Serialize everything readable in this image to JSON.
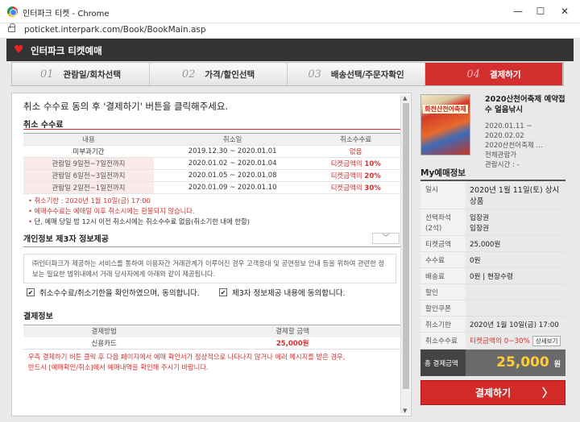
{
  "window": {
    "title": "인터파크 티켓 - Chrome",
    "minimize": "—",
    "maximize": "☐",
    "close": "✕"
  },
  "address": {
    "url": "poticket.interpark.com/Book/BookMain.asp"
  },
  "header": {
    "brand": "인터파크 티켓예매"
  },
  "steps": [
    {
      "num": "01",
      "label": "관람일/회차선택"
    },
    {
      "num": "02",
      "label": "가격/할인선택"
    },
    {
      "num": "03",
      "label": "배송선택/주문자확인"
    },
    {
      "num": "04",
      "label": "결제하기"
    }
  ],
  "main": {
    "intro": "취소 수수료 동의 후 '결제하기' 버튼을 클릭해주세요.",
    "cancel_title": "취소 수수료",
    "cancel_headers": [
      "내용",
      "취소일",
      "취소수수료"
    ],
    "cancel_rows": [
      {
        "c": "미부과기간",
        "d": "2019.12.30 ~ 2020.01.01",
        "f": "없음"
      },
      {
        "c": "관람일 9일전~7일전까지",
        "d": "2020.01.02 ~ 2020.01.04",
        "f1": "티켓금액의 ",
        "f2": "10%"
      },
      {
        "c": "관람일 6일전~3일전까지",
        "d": "2020.01.05 ~ 2020.01.08",
        "f1": "티켓금액의 ",
        "f2": "20%"
      },
      {
        "c": "관람일 2일전~1일전까지",
        "d": "2020.01.09 ~ 2020.01.10",
        "f1": "티켓금액의 ",
        "f2": "30%"
      }
    ],
    "notes": [
      "취소기한 : 2020년 1월 10일(금) 17:00",
      "예매수수료는 예매일 이후 취소시에는 환불되지 않습니다.",
      "단, 예매 당일 밤 12시 이전 취소시에는 취소수수료 없음(취소기한 내에 한함)"
    ],
    "privacy_title": "개인정보 제3자 정보제공",
    "privacy_text": "㈜인터파크가 제공하는 서비스를 통하여 이용자간 거래관계가 이루어진 경우 고객응대 및 공연정보 안내 등을 위하여 관련한 정보는 필요한 범위내에서 거래 당사자에게 아래와 같이 제공됩니다.",
    "dropdown": "﹀",
    "agree1": "취소수수료/취소기한을 확인하였으며, 동의합니다.",
    "agree2": "제3자 정보제공 내용에 동의합니다.",
    "check_mark": "✔",
    "payment_title": "결제정보",
    "payment_headers": [
      "결제방법",
      "결제할 금액"
    ],
    "payment_method": "신용카드",
    "payment_amount": "25,000원",
    "warn1": "우측 결제하기 버튼 클릭 후 다음 페이지에서 예매 확인서가 정상적으로 나타나지 않거나 에러 메시지를 받은 경우,",
    "warn2": "반드시 [예매확인/취소]에서 예매내역을 확인해 주시기 바랍니다."
  },
  "side": {
    "poster_text": "화천산천어축제",
    "title": "2020산천어축제 예약접수 얼음낚시",
    "info": [
      "2020.01.11 ~",
      "2020.02.02",
      "2020산천어축제 ...",
      "전체관람가",
      "관람시간 : -"
    ],
    "my_title": "My예매정보",
    "rows": [
      {
        "k": "일시",
        "v": "2020년 1월 11일(토) 상시상품"
      },
      {
        "k": "선택좌석\n(2석)",
        "v": "입장권\n입장권"
      },
      {
        "k": "티켓금액",
        "v": "25,000원"
      },
      {
        "k": "수수료",
        "v": "0원"
      },
      {
        "k": "배송료",
        "v": "0원 | 현장수령"
      },
      {
        "k": "할인",
        "v": ""
      },
      {
        "k": "할인쿠폰",
        "v": ""
      },
      {
        "k": "취소기한",
        "v": "2020년 1월 10일(금) 17:00"
      },
      {
        "k": "취소수수료",
        "v": "티켓금액의 0~30%"
      }
    ],
    "detail_btn": "상세보기",
    "total_label": "총 결제금액",
    "total_value": "25,000",
    "total_unit": "원",
    "pay_button": "결제하기",
    "pay_arrow": "〉"
  },
  "colors": {
    "accent": "#d32f2f",
    "header": "#333333"
  }
}
